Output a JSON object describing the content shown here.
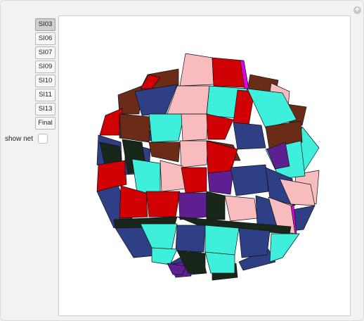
{
  "controls": {
    "stage_buttons": [
      {
        "label": "SI03",
        "active": true
      },
      {
        "label": "SI06",
        "active": false
      },
      {
        "label": "SI07",
        "active": false
      },
      {
        "label": "SI09",
        "active": false
      },
      {
        "label": "SI10",
        "active": false
      },
      {
        "label": "SI11",
        "active": false
      },
      {
        "label": "SI13",
        "active": false
      },
      {
        "label": "Final",
        "active": false
      }
    ],
    "show_net": {
      "label": "show net",
      "checked": false
    }
  },
  "panel": {
    "plus_icon": "+"
  },
  "model": {
    "icon": "polyhedron-model",
    "palette": {
      "navy": "#2f3f86",
      "pink": "#f8bcbf",
      "red": "#d10005",
      "cyan": "#3ef0dc",
      "brown": "#6a2c17",
      "purple": "#5e2091",
      "dark": "#18271a",
      "magenta": "#e000e0"
    }
  }
}
